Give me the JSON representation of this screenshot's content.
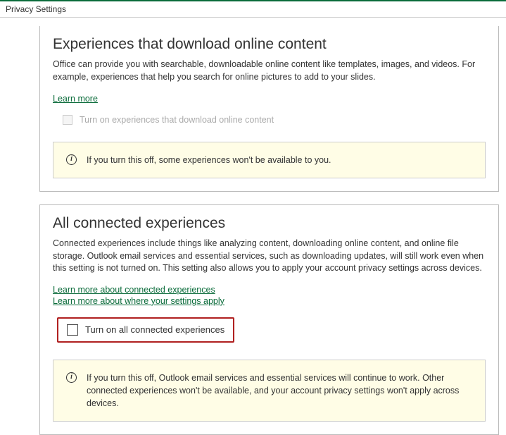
{
  "window": {
    "title": "Privacy Settings"
  },
  "section1": {
    "title": "Experiences that download online content",
    "desc": "Office can provide you with searchable, downloadable online content like templates, images, and videos. For example, experiences that help you search for online pictures to add to your slides.",
    "learn_more": "Learn more",
    "checkbox_label": "Turn on experiences that download online content",
    "info": "If you turn this off, some experiences won't be available to you."
  },
  "section2": {
    "title": "All connected experiences",
    "desc": "Connected experiences include things like analyzing content, downloading online content, and online file storage. Outlook email services and essential services, such as downloading updates, will still work even when this setting is not turned on. This setting also allows you to apply your account privacy settings across devices.",
    "link1": "Learn more about connected experiences",
    "link2": "Learn more about where your settings apply",
    "checkbox_label": "Turn on all connected experiences",
    "info": "If you turn this off, Outlook email services and essential services will continue to work. Other connected experiences won't be available, and your account privacy settings won't apply across devices."
  },
  "icons": {
    "info_glyph": "i"
  }
}
